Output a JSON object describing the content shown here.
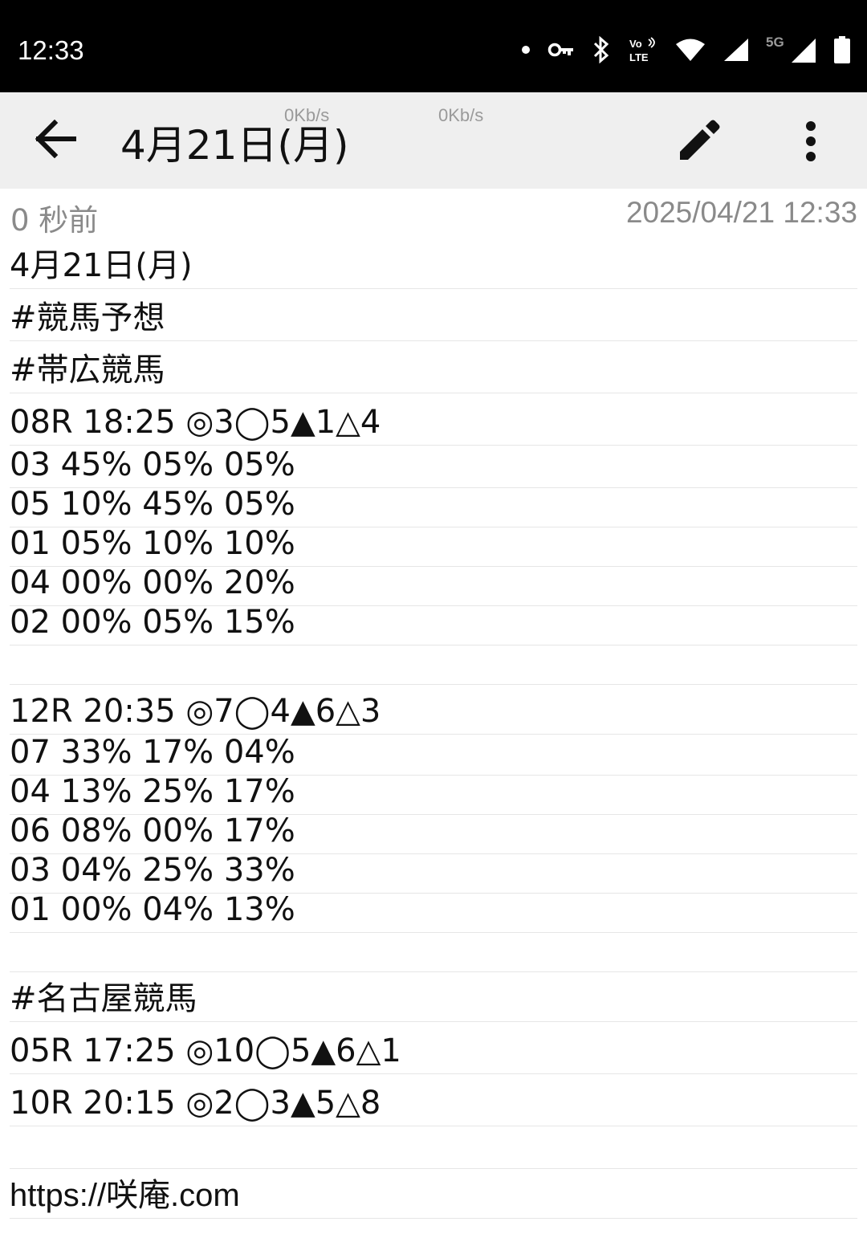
{
  "status_bar": {
    "time": "12:33",
    "icons": [
      "dot-icon",
      "vpn-key-icon",
      "bluetooth-icon",
      "volte-icon",
      "wifi-icon",
      "signal-icon",
      "signal-5g-icon",
      "battery-icon"
    ],
    "volte_label_top": "Vo",
    "volte_label_bottom": "LTE",
    "network_label": "5G"
  },
  "app_bar": {
    "title": "4月21日(月)",
    "net_speed_1": "0Kb/s",
    "net_speed_2": "0Kb/s",
    "icons": [
      "arrow-back-icon",
      "pencil-icon",
      "more-vert-icon"
    ]
  },
  "meta": {
    "relative_time": "0 秒前",
    "timestamp": "2025/04/21 12:33"
  },
  "note": {
    "lines": [
      "4月21日(月)",
      "#競馬予想",
      "#帯広競馬",
      "08R 18:25 ◎3◯5▲1△4",
      "03 45% 05% 05%",
      "05 10% 45% 05%",
      "01 05% 10% 10%",
      "04 00% 00% 20%",
      "02 00% 05% 15%",
      "",
      "12R 20:35 ◎7◯4▲6△3",
      "07 33% 17% 04%",
      "04 13% 25% 17%",
      "06 08% 00% 17%",
      "03 04% 25% 33%",
      "01 00% 04% 13%",
      "",
      "#名古屋競馬",
      "05R 17:25 ◎10◯5▲6△1",
      "10R 20:15 ◎2◯3▲5△8",
      "",
      "https://咲庵.com"
    ]
  }
}
